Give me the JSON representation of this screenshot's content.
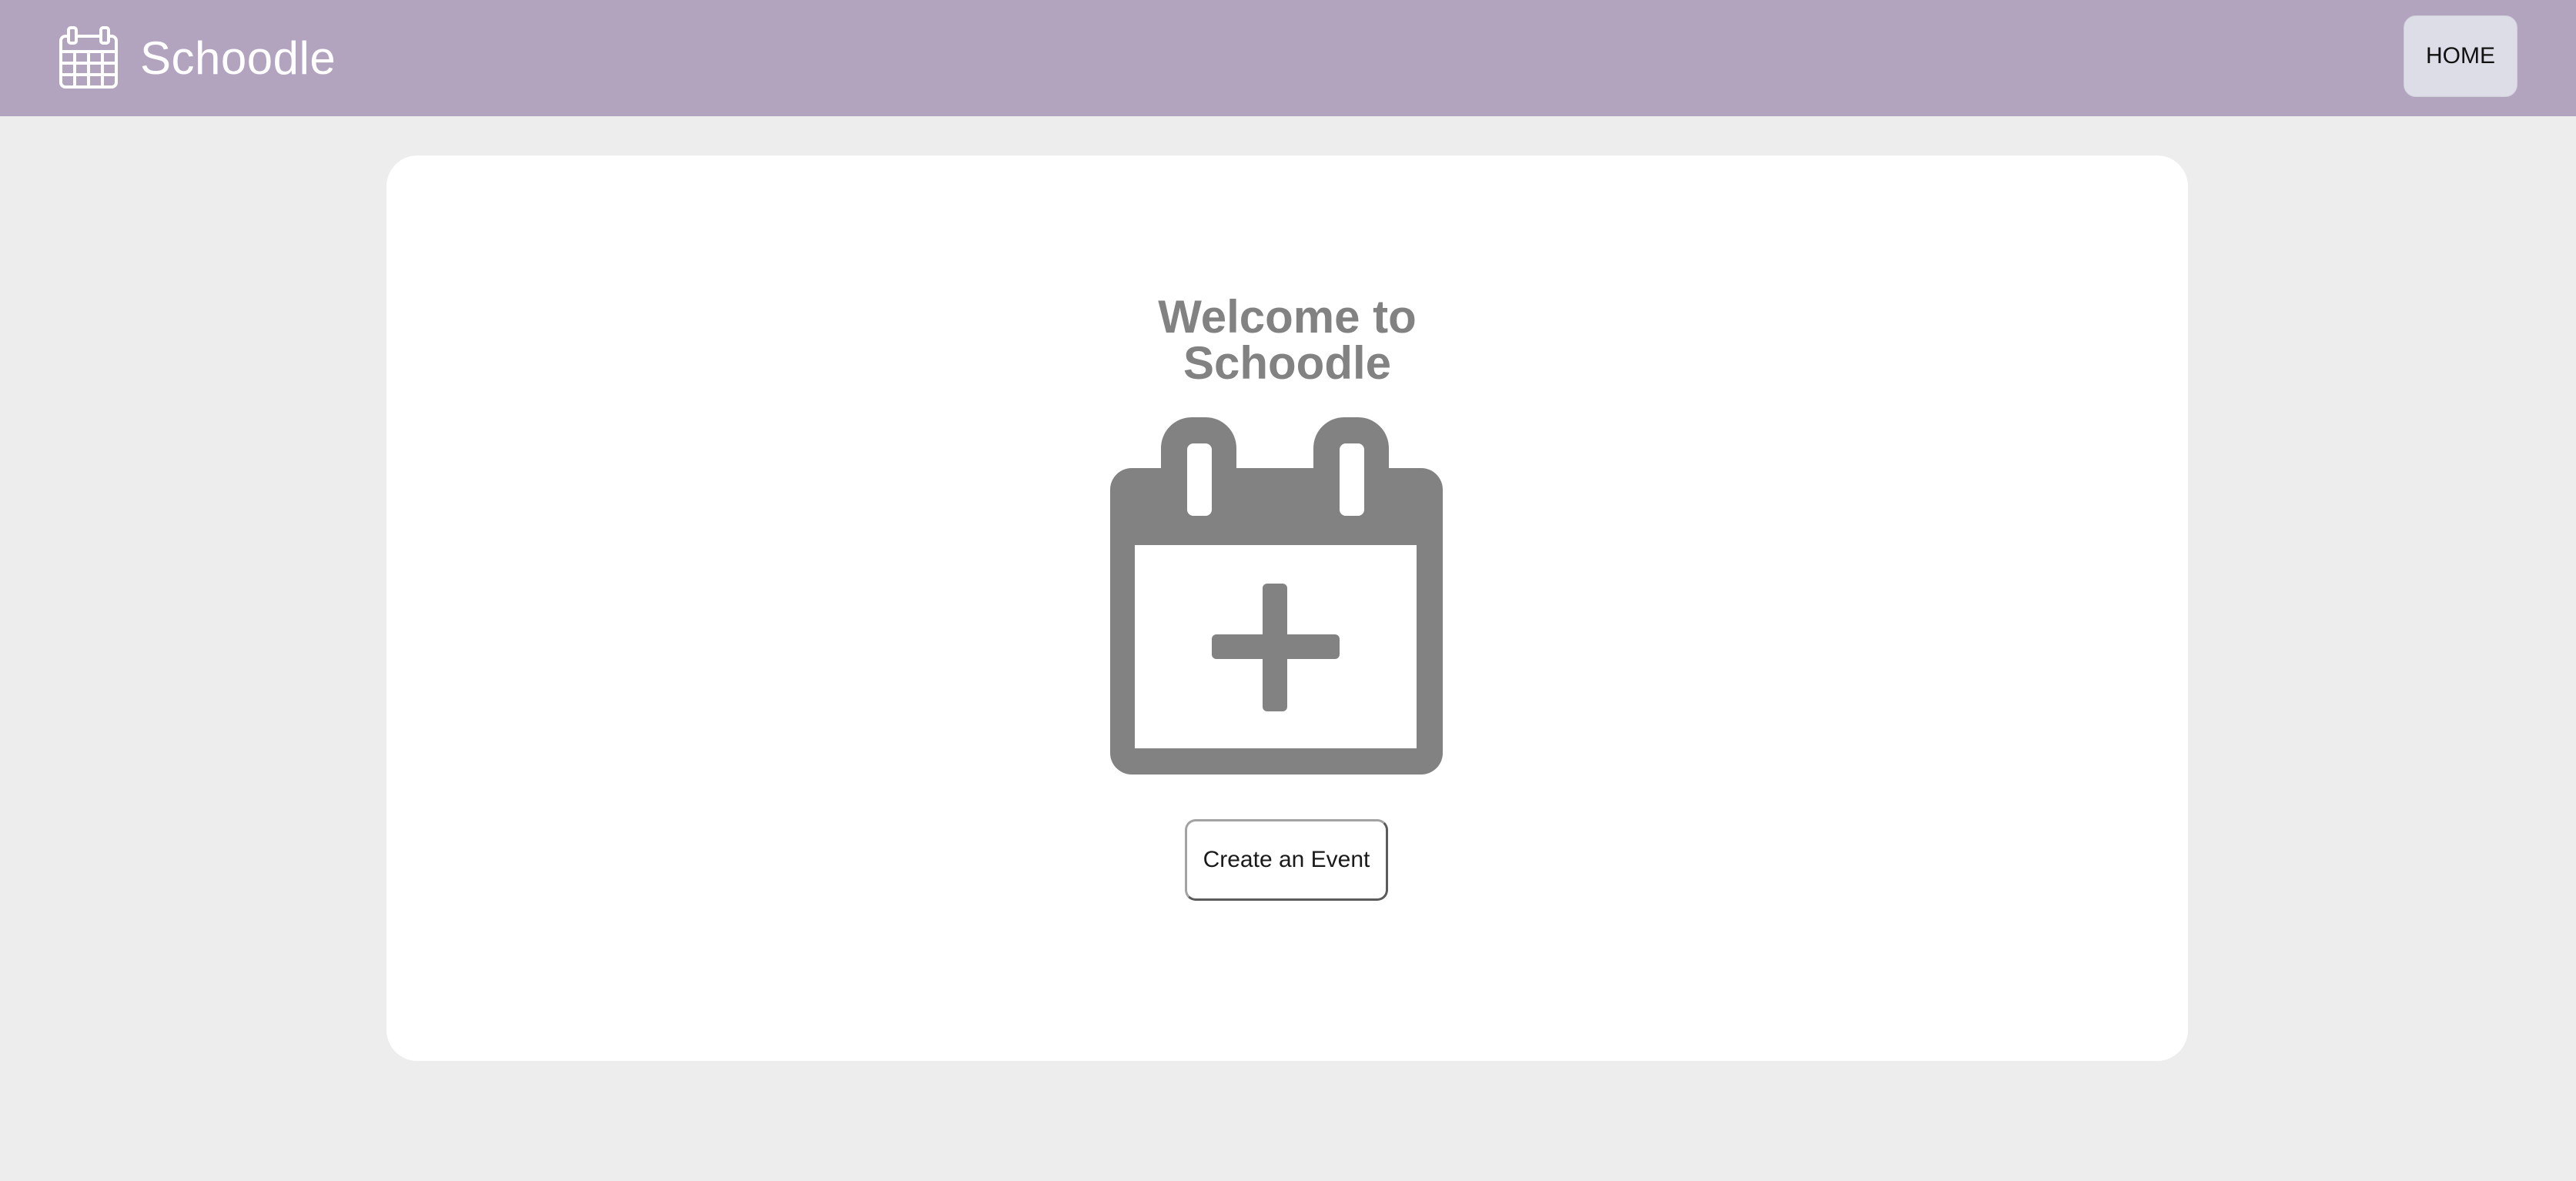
{
  "header": {
    "brand_name": "Schoodle",
    "brand_icon": "calendar-icon",
    "home_label": "HOME"
  },
  "main": {
    "welcome_line1": "Welcome to",
    "welcome_line2": "Schoodle",
    "hero_icon": "calendar-plus-icon",
    "create_button_label": "Create an Event"
  },
  "colors": {
    "header_bg": "#b2a3bf",
    "page_bg": "#ededed",
    "card_bg": "#ffffff",
    "accent_gray": "#828282",
    "home_button_bg": "#dcdde6"
  }
}
